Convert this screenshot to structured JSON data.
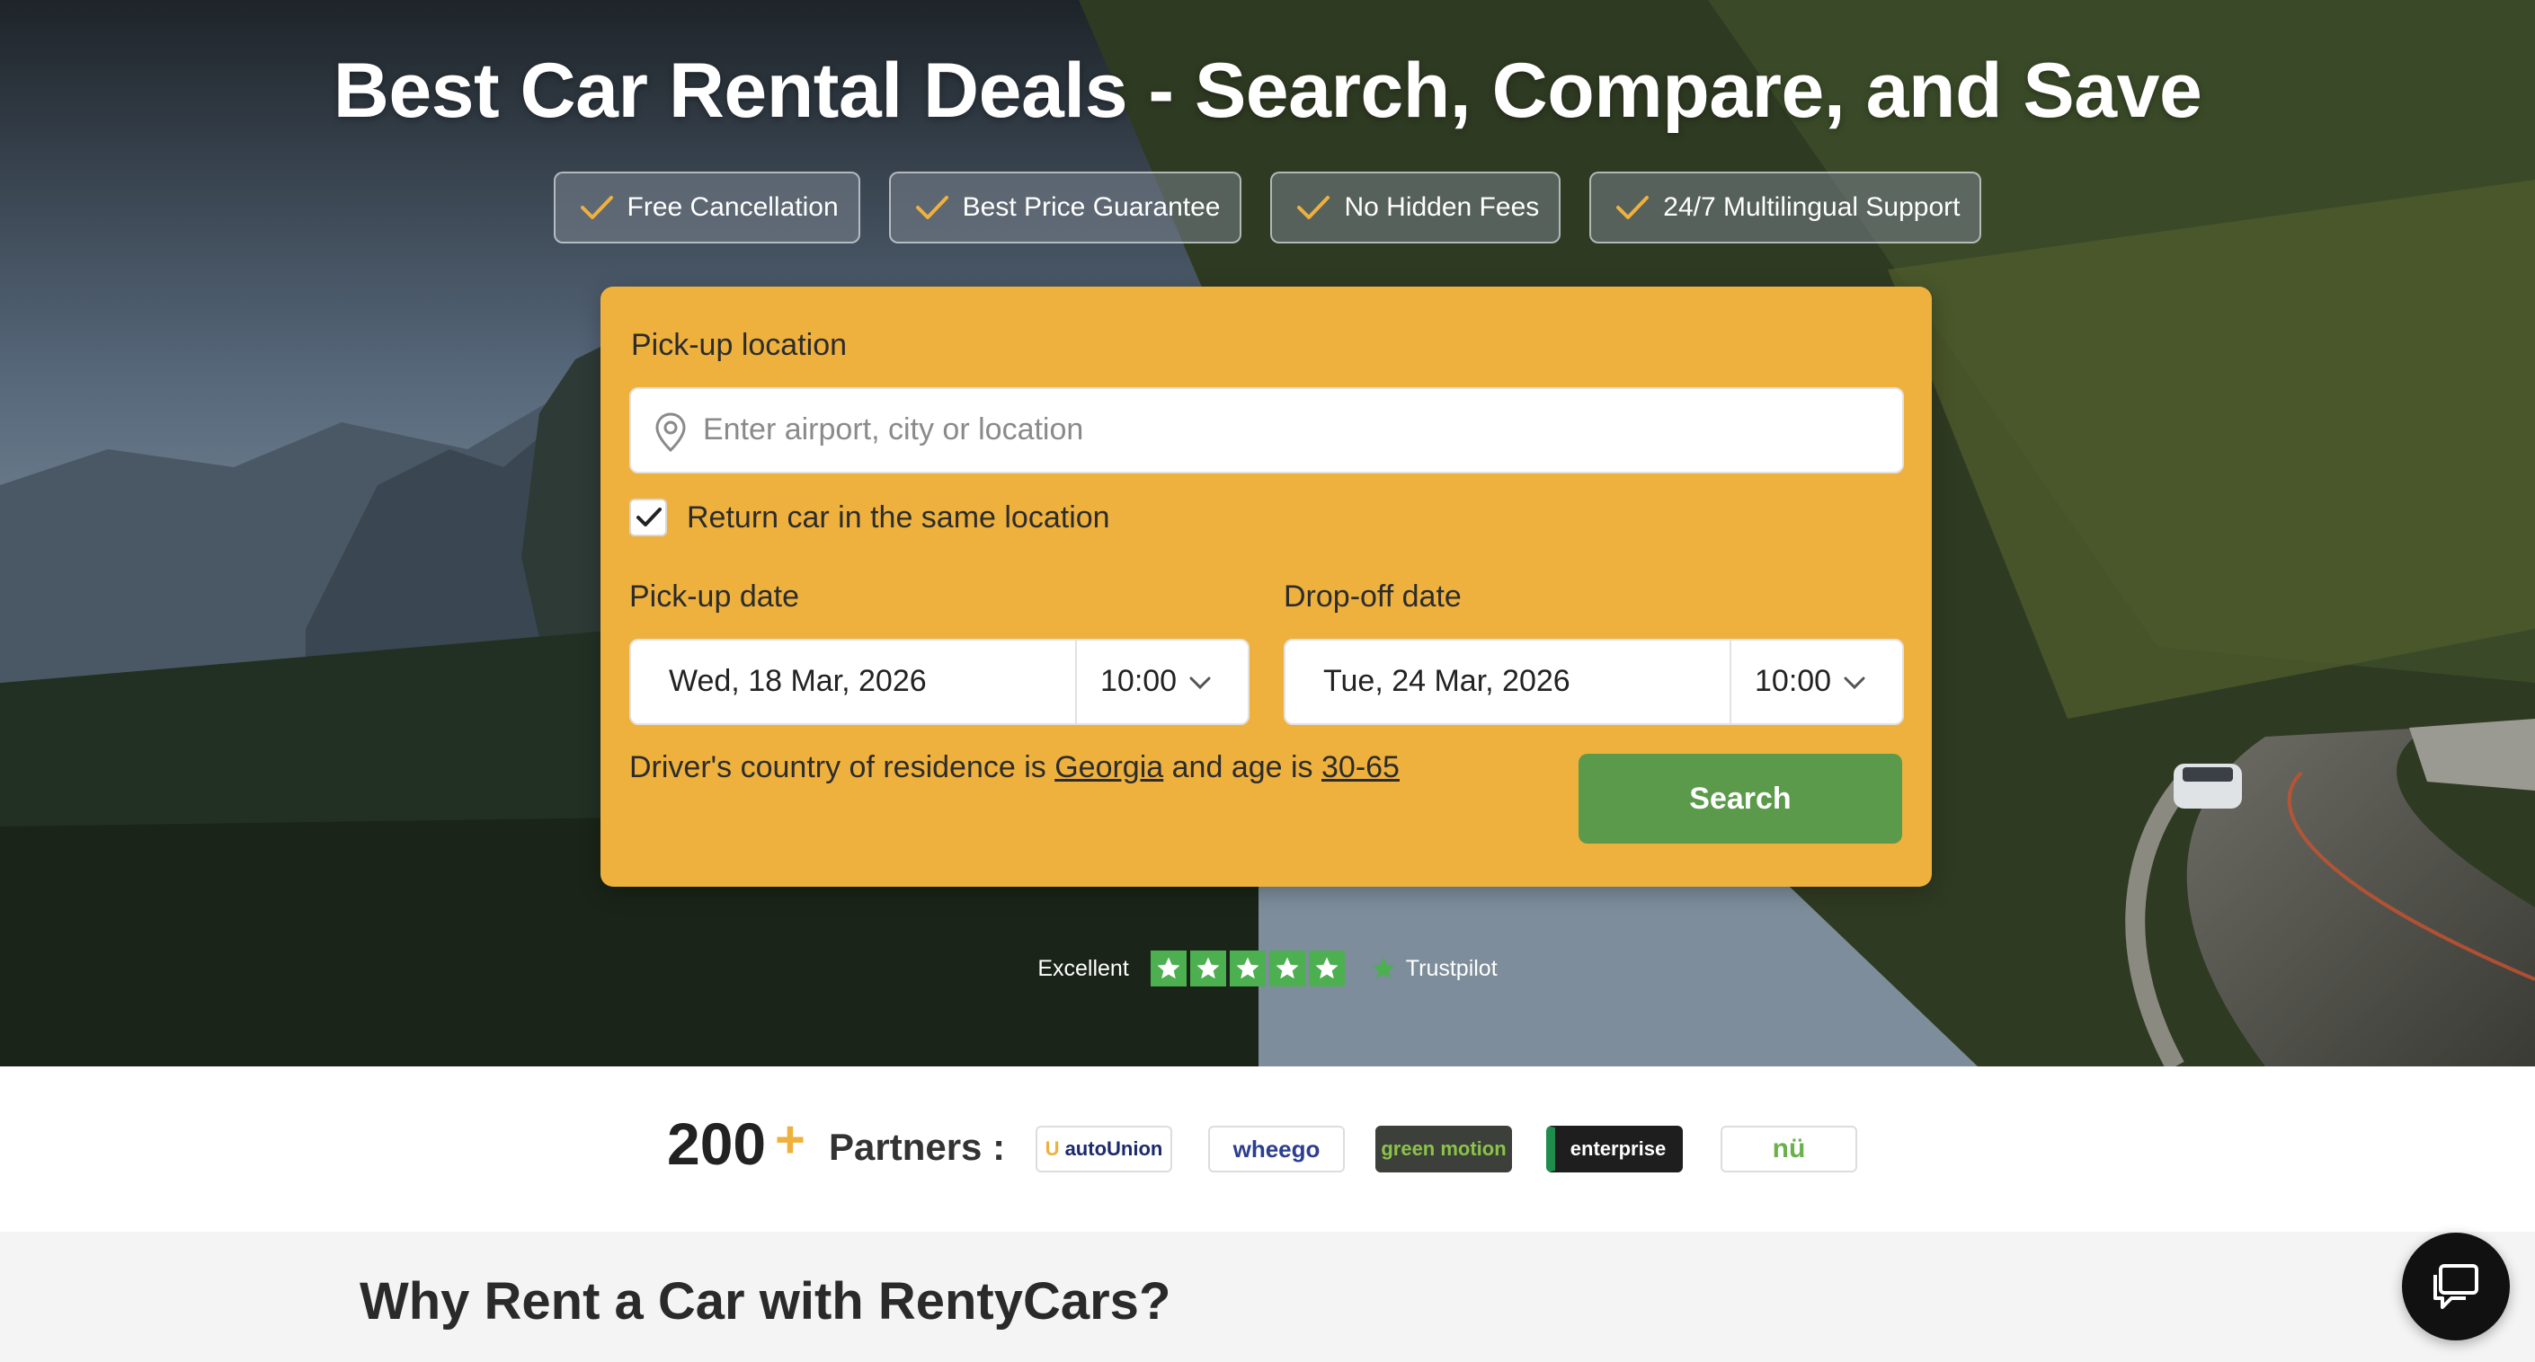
{
  "hero": {
    "title": "Best Car Rental Deals - Search, Compare, and Save",
    "badges": [
      {
        "label": "Free Cancellation",
        "icon": "check-icon"
      },
      {
        "label": "Best Price Guarantee",
        "icon": "check-icon"
      },
      {
        "label": "No Hidden Fees",
        "icon": "check-icon"
      },
      {
        "label": "24/7 Multilingual Support",
        "icon": "check-icon"
      }
    ]
  },
  "search": {
    "pickup_location_label": "Pick-up location",
    "pickup_location_placeholder": "Enter airport, city or location",
    "return_same_label": "Return car in the same location",
    "return_same_checked": true,
    "pickup_date_label": "Pick-up date",
    "pickup_date": "Wed, 18 Mar, 2026",
    "pickup_time": "10:00",
    "dropoff_date_label": "Drop-off date",
    "dropoff_date": "Tue, 24 Mar, 2026",
    "dropoff_time": "10:00",
    "residence_prefix": "Driver's country of residence is",
    "residence_country": "Georgia",
    "residence_middle": "and age is",
    "residence_age": "30-65",
    "search_button": "Search"
  },
  "trustpilot": {
    "rating_text": "Excellent",
    "stars": 5,
    "brand": "Trustpilot"
  },
  "partners": {
    "count": "200",
    "plus": "+",
    "label": "Partners :",
    "logos": [
      "autoUnion",
      "wheego",
      "green motion",
      "enterprise",
      "nü"
    ]
  },
  "why": {
    "title": "Why Rent a Car with RentyCars?"
  },
  "colors": {
    "accent": "#eeb13e",
    "search_button": "#5b9a4a",
    "trustpilot_green": "#4caf50"
  }
}
